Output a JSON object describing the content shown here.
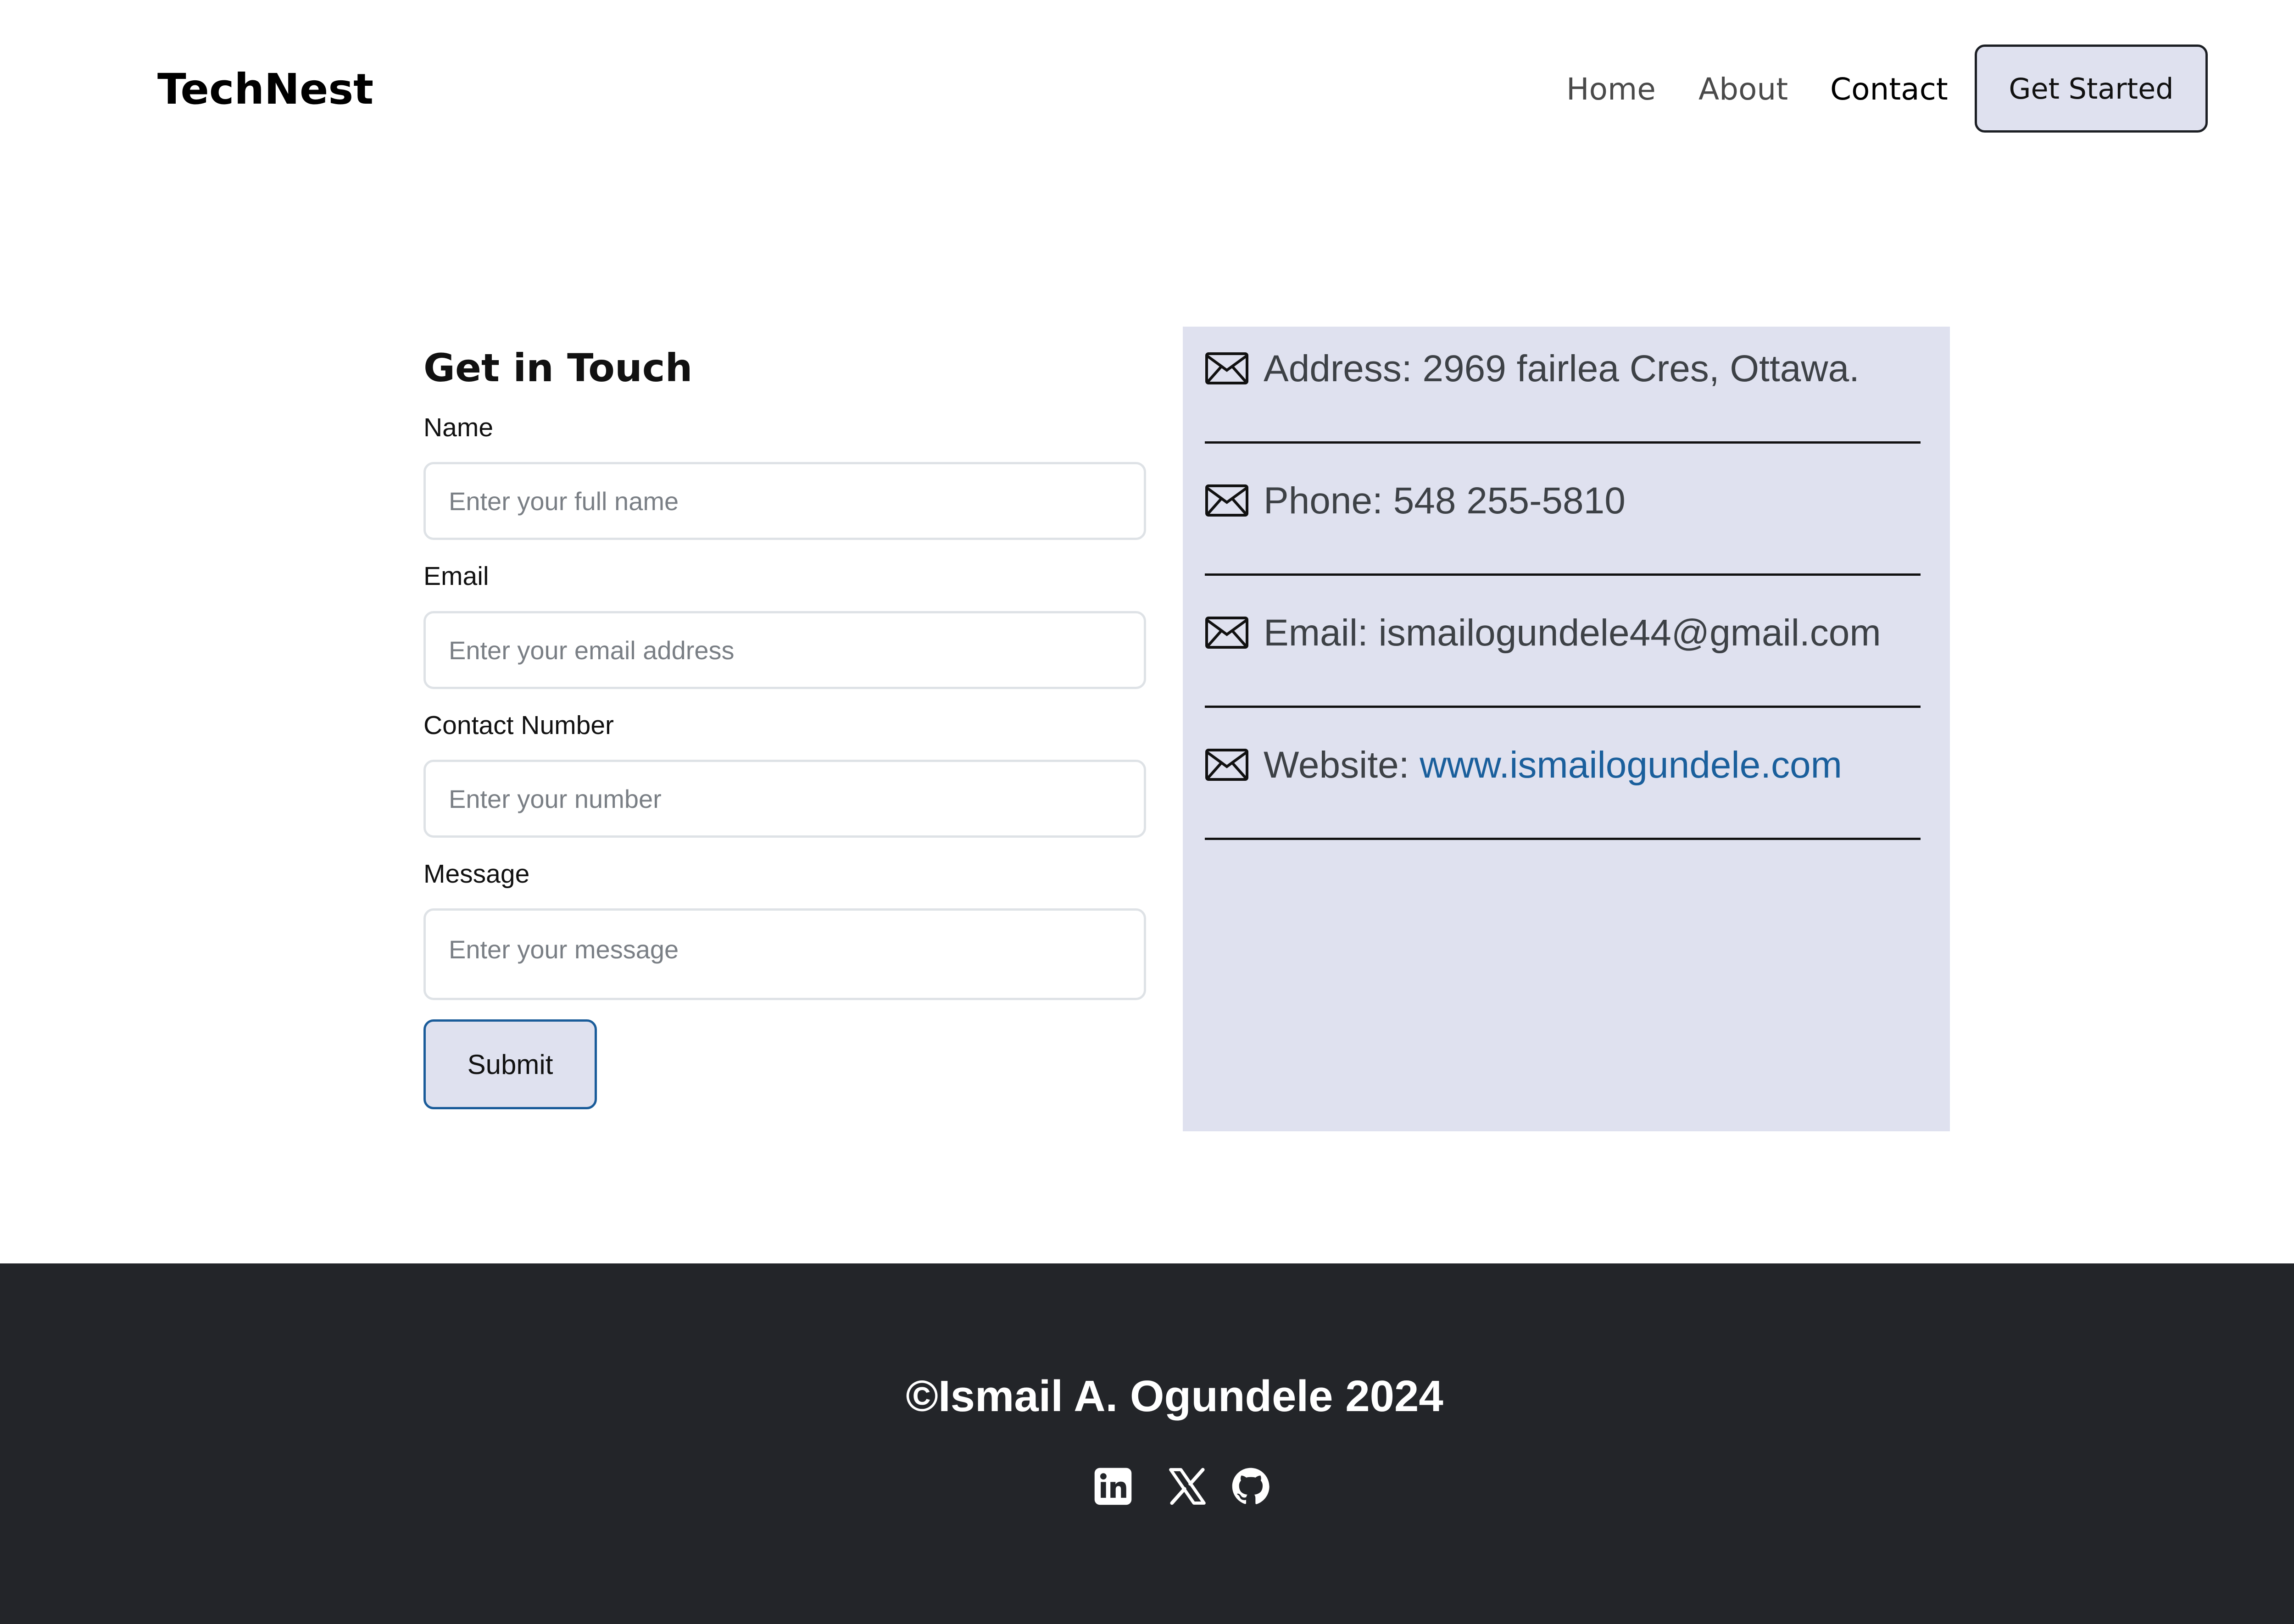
{
  "header": {
    "brand": "TechNest",
    "nav": [
      {
        "label": "Home",
        "active": false
      },
      {
        "label": "About",
        "active": false
      },
      {
        "label": "Contact",
        "active": true
      }
    ],
    "cta_label": "Get Started"
  },
  "form": {
    "title": "Get in Touch",
    "fields": [
      {
        "label": "Name",
        "placeholder": "Enter your full name",
        "value": ""
      },
      {
        "label": "Email",
        "placeholder": "Enter your email address",
        "value": ""
      },
      {
        "label": "Contact Number",
        "placeholder": "Enter your number",
        "value": ""
      },
      {
        "label": "Message",
        "placeholder": "Enter your message",
        "value": ""
      }
    ],
    "submit_label": "Submit"
  },
  "info": {
    "icon": "envelope-icon",
    "items": [
      {
        "prefix": "Address: ",
        "value": "2969 fairlea Cres, Ottawa."
      },
      {
        "prefix": "Phone: ",
        "value": "548 255-5810"
      },
      {
        "prefix": "Email: ",
        "value": "ismailogundele44@gmail.com"
      },
      {
        "prefix": "Website: ",
        "link": "www.ismailogundele.com"
      }
    ]
  },
  "footer": {
    "copyright": "©Ismail A. Ogundele 2024",
    "social_icons": [
      "linkedin-icon",
      "x-twitter-icon",
      "github-icon"
    ]
  },
  "colors": {
    "panel_bg": "#dfe1ef",
    "footer_bg": "#232529",
    "link": "#1a5f9c",
    "submit_border": "#1a5c9a"
  }
}
